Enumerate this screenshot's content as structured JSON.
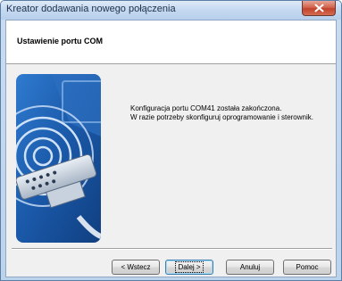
{
  "window": {
    "title": "Kreator dodawania nowego połączenia"
  },
  "header": {
    "title": "Ustawienie portu COM"
  },
  "message": {
    "line1": "Konfiguracja portu COM41 została zakończona.",
    "line2": "W razie potrzeby skonfiguruj oprogramowanie i sterownik."
  },
  "buttons": {
    "back": "< Wstecz",
    "next": "Dalej >",
    "cancel": "Anuluj",
    "help": "Pomoc"
  },
  "colors": {
    "hero_blue": "#1f5fae",
    "title_bar": "#c6daf1",
    "close_red": "#c2432b"
  }
}
